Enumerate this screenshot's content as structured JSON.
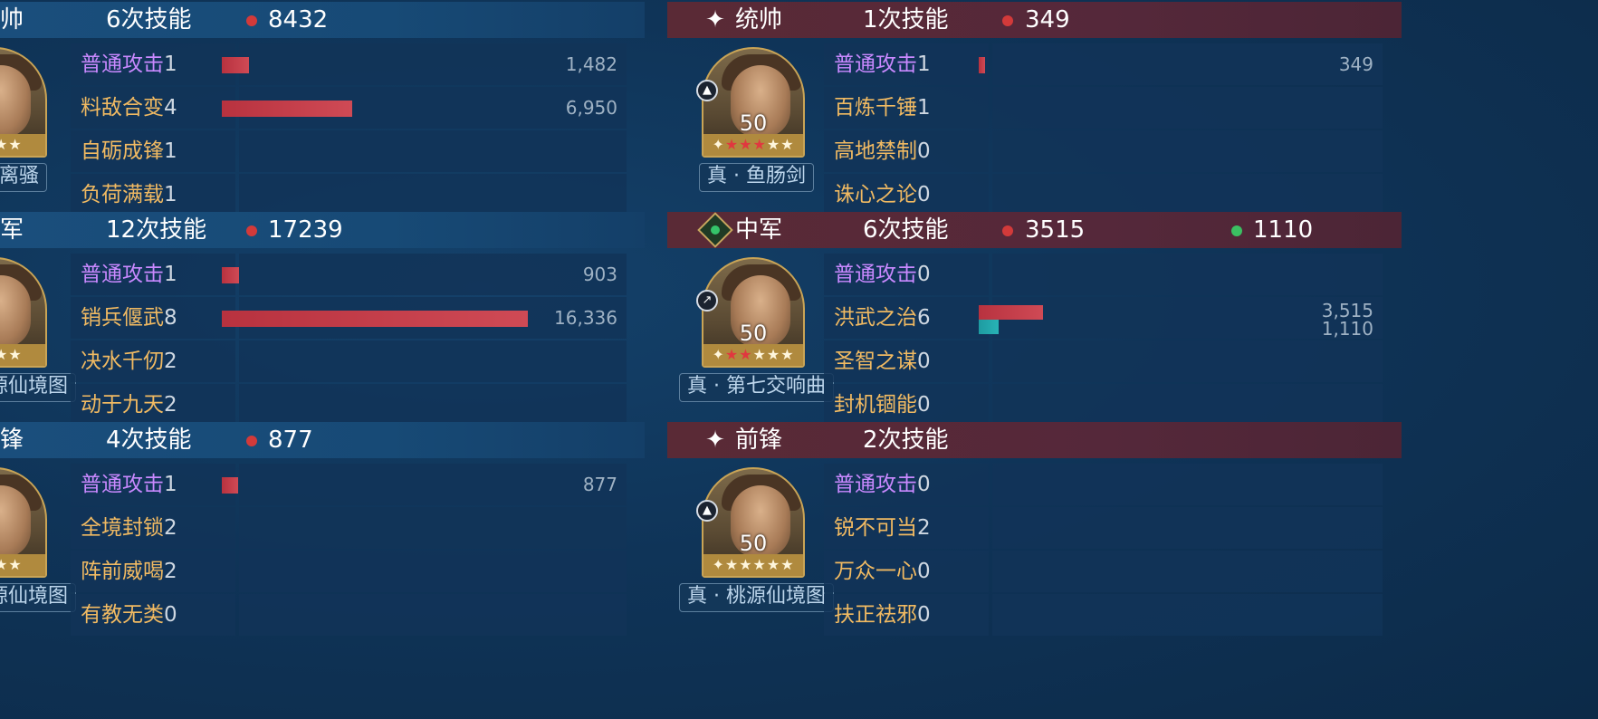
{
  "left": {
    "units": [
      {
        "position": "帅",
        "casts": "6次技能",
        "damage": "8432",
        "level": "0",
        "gear": "离骚",
        "skills": [
          {
            "name": "普通攻击",
            "count": "1",
            "value": "1,482",
            "bar": 0.09,
            "normal": true
          },
          {
            "name": "料敌合变",
            "count": "4",
            "value": "6,950",
            "bar": 0.425,
            "normal": false
          },
          {
            "name": "自砺成锋",
            "count": "1",
            "value": "",
            "bar": 0,
            "normal": false
          },
          {
            "name": "负荷满载",
            "count": "1",
            "value": "",
            "bar": 0,
            "normal": false
          }
        ]
      },
      {
        "position": "军",
        "casts": "12次技能",
        "damage": "17239",
        "level": "0",
        "gear": "源仙境图",
        "skills": [
          {
            "name": "普通攻击",
            "count": "1",
            "value": "903",
            "bar": 0.055,
            "normal": true
          },
          {
            "name": "销兵偃武",
            "count": "8",
            "value": "16,336",
            "bar": 1.0,
            "normal": false
          },
          {
            "name": "决水千仞",
            "count": "2",
            "value": "",
            "bar": 0,
            "normal": false
          },
          {
            "name": "动于九天",
            "count": "2",
            "value": "",
            "bar": 0,
            "normal": false
          }
        ]
      },
      {
        "position": "锋",
        "casts": "4次技能",
        "damage": "877",
        "level": "0",
        "gear": "源仙境图",
        "skills": [
          {
            "name": "普通攻击",
            "count": "1",
            "value": "877",
            "bar": 0.054,
            "normal": true
          },
          {
            "name": "全境封锁",
            "count": "2",
            "value": "",
            "bar": 0,
            "normal": false
          },
          {
            "name": "阵前威喝",
            "count": "2",
            "value": "",
            "bar": 0,
            "normal": false
          },
          {
            "name": "有教无类",
            "count": "0",
            "value": "",
            "bar": 0,
            "normal": false
          }
        ]
      }
    ]
  },
  "right": {
    "units": [
      {
        "position": "统帅",
        "position_icon": "compass-star-icon",
        "casts": "1次技能",
        "damage": "349",
        "level": "50",
        "gear": "真 · 鱼肠剑",
        "type_icon": "cavalry-icon",
        "stars": {
          "red": 3,
          "total": 5
        },
        "skills": [
          {
            "name": "普通攻击",
            "count": "1",
            "value": "349",
            "bar": 0.02,
            "normal": true
          },
          {
            "name": "百炼千锤",
            "count": "1",
            "value": "",
            "bar": 0,
            "normal": false
          },
          {
            "name": "高地禁制",
            "count": "0",
            "value": "",
            "bar": 0,
            "normal": false
          },
          {
            "name": "诛心之论",
            "count": "0",
            "value": "",
            "bar": 0,
            "normal": false
          }
        ]
      },
      {
        "position": "中军",
        "position_icon": "heal-diamond-icon",
        "casts": "6次技能",
        "damage": "3515",
        "heal": "1110",
        "level": "50",
        "gear": "真 · 第七交响曲",
        "type_icon": "spear-icon",
        "stars": {
          "red": 2,
          "total": 5
        },
        "skills": [
          {
            "name": "普通攻击",
            "count": "0",
            "value": "",
            "bar": 0,
            "normal": true
          },
          {
            "name": "洪武之治",
            "count": "6",
            "value": "3,515",
            "value2": "1,110",
            "bar": 0.215,
            "bar2": 0.068,
            "normal": false
          },
          {
            "name": "圣智之谋",
            "count": "0",
            "value": "",
            "bar": 0,
            "normal": false
          },
          {
            "name": "封机锢能",
            "count": "0",
            "value": "",
            "bar": 0,
            "normal": false
          }
        ]
      },
      {
        "position": "前锋",
        "position_icon": "compass-star-icon",
        "casts": "2次技能",
        "level": "50",
        "gear": "真 · 桃源仙境图",
        "type_icon": "cavalry-icon",
        "stars": {
          "red": 0,
          "total": 5
        },
        "skills": [
          {
            "name": "普通攻击",
            "count": "0",
            "value": "",
            "bar": 0,
            "normal": true
          },
          {
            "name": "锐不可当",
            "count": "2",
            "value": "",
            "bar": 0,
            "normal": false
          },
          {
            "name": "万众一心",
            "count": "0",
            "value": "",
            "bar": 0,
            "normal": false
          },
          {
            "name": "扶正祛邪",
            "count": "0",
            "value": "",
            "bar": 0,
            "normal": false
          }
        ]
      }
    ]
  },
  "colors": {
    "damage_dot": "#d23a3a",
    "heal_dot": "#3bbf62",
    "skill_name": "#f1ba62",
    "normal_attack": "#c989ff",
    "damage_bar": "#c23f4b",
    "heal_bar": "#22a8ac"
  }
}
